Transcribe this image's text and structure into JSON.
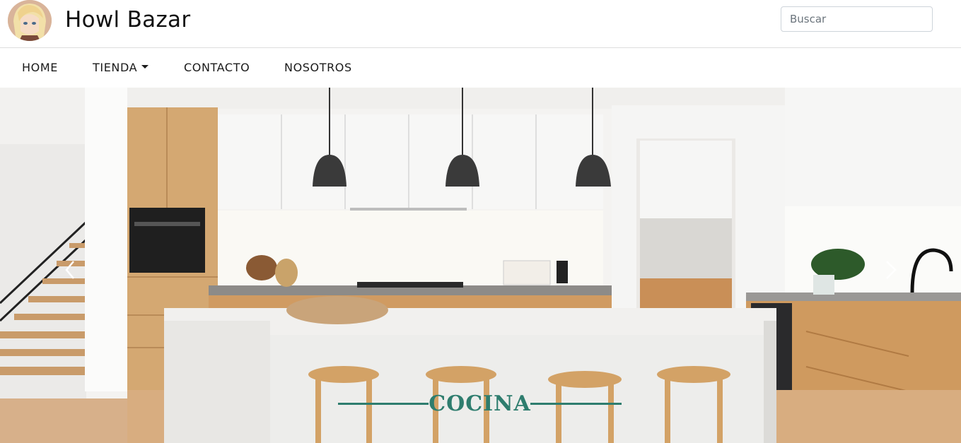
{
  "header": {
    "brand": "Howl Bazar",
    "search_placeholder": "Buscar"
  },
  "nav": {
    "items": [
      {
        "label": "HOME"
      },
      {
        "label": "TIENDA",
        "dropdown": true
      },
      {
        "label": "CONTACTO"
      },
      {
        "label": "NOSOTROS"
      }
    ]
  },
  "carousel": {
    "caption": "COCINA",
    "caption_color": "#2e7d6e",
    "prev_icon": "chevron-left-icon",
    "next_icon": "chevron-right-icon"
  }
}
